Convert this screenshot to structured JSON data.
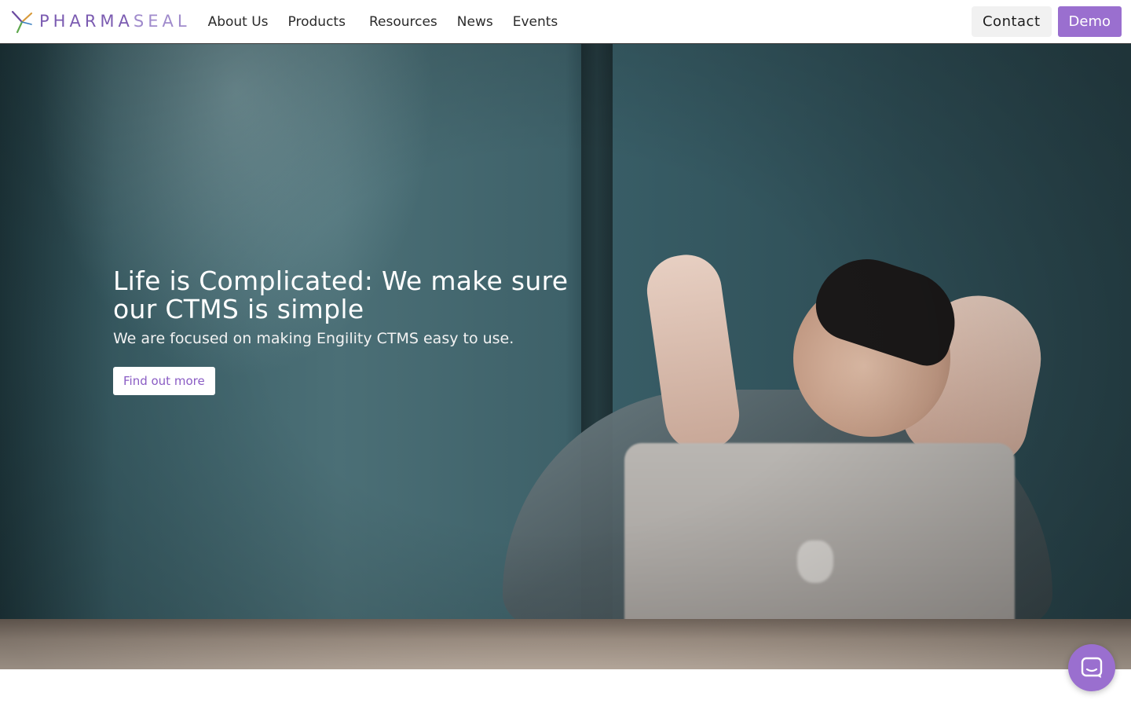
{
  "brand": {
    "name_part_a": "PHARMA",
    "name_part_b": "SEAL",
    "logo_icon": "pharmaseal-star-icon",
    "colors": {
      "primary": "#7b5bb1",
      "light": "#a08bcc"
    }
  },
  "nav": {
    "items": [
      {
        "label": "About Us"
      },
      {
        "label": "Products"
      },
      {
        "label": "Resources"
      },
      {
        "label": "News"
      },
      {
        "label": "Events"
      }
    ]
  },
  "header_actions": {
    "contact_label": "Contact",
    "demo_label": "Demo",
    "demo_color": "#9a6fcf"
  },
  "hero": {
    "title": "Life is Complicated: We make sure our CTMS is simple",
    "subtitle": "We are focused on making Engility CTMS easy to use.",
    "cta_label": "Find out more",
    "cta_color": "#8a5cc4",
    "background": "man-relaxing-at-laptop-photo"
  },
  "chat": {
    "icon": "chat-icon",
    "color": "#9a6fcf"
  }
}
